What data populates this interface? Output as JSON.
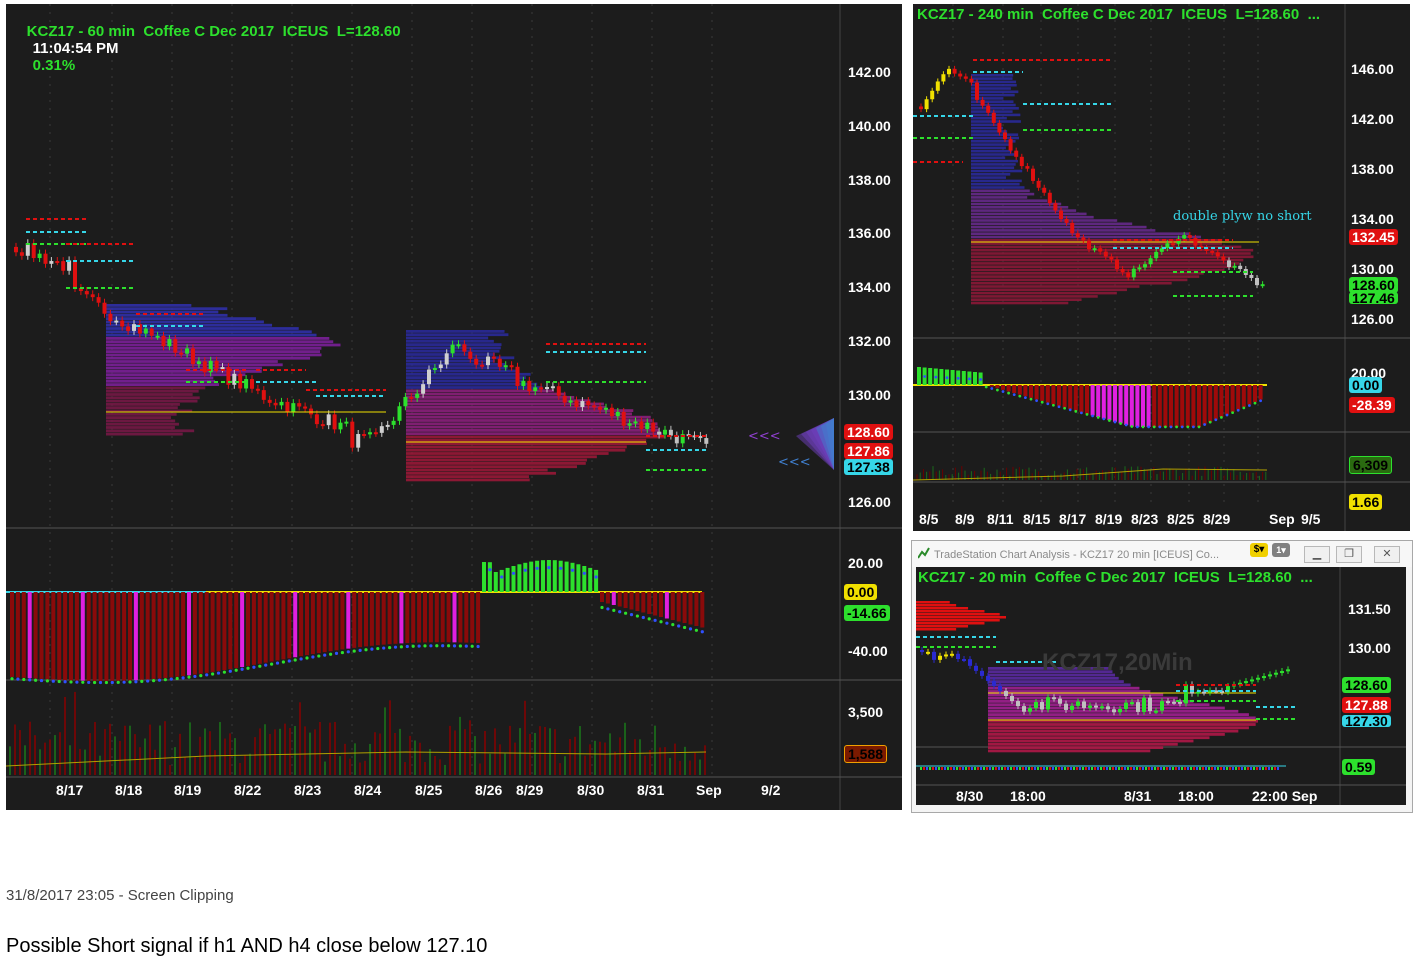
{
  "main_chart": {
    "title_left": "KCZ17 - 60 min  Coffee C Dec 2017  ICEUS  L=128.60",
    "time": "11:04:54 PM",
    "change": "0.31%",
    "price_ticks": [
      "142.00",
      "140.00",
      "138.00",
      "136.00",
      "134.00",
      "132.00",
      "130.00",
      "128.00",
      "126.00"
    ],
    "tags": {
      "last": "128.60",
      "red": "127.86",
      "cyan": "127.38"
    },
    "osc_ticks": [
      "20.00",
      "-40.00"
    ],
    "osc_tags": {
      "zero": "0.00",
      "value": "-14.66"
    },
    "vol_tick": "3,500",
    "vol_tag": "1,588",
    "dates": [
      "8/17",
      "8/18",
      "8/19",
      "8/22",
      "8/23",
      "8/24",
      "8/25",
      "8/26",
      "8/29",
      "8/30",
      "8/31",
      "Sep",
      "9/2"
    ]
  },
  "h4_chart": {
    "title": "KCZ17 - 240 min  Coffee C Dec 2017  ICEUS  L=128.60  ...",
    "note": "double plyw no short",
    "price_ticks": [
      "146.00",
      "142.00",
      "138.00",
      "134.00",
      "130.00",
      "126.00"
    ],
    "tags": {
      "red": "132.45",
      "green": "128.60",
      "green2": "127.46"
    },
    "osc_ticks": [
      "20.00"
    ],
    "osc_tags": {
      "zero": "0.00",
      "value": "-28.39"
    },
    "vol_tags": {
      "vol": "6,309",
      "other": "1.66"
    },
    "dates": [
      "8/5",
      "8/9",
      "8/11",
      "8/15",
      "8/17",
      "8/19",
      "8/23",
      "8/25",
      "8/29",
      "Sep",
      "9/5"
    ]
  },
  "m20_window": {
    "window_title": "TradeStation Chart Analysis - KCZ17 20 min [ICEUS] Co...",
    "title": "KCZ17 - 20 min  Coffee C Dec 2017  ICEUS  L=128.60  ...",
    "watermark": "KCZ17,20Min",
    "price_ticks": [
      "131.50",
      "130.00"
    ],
    "tags": {
      "green": "128.60",
      "red": "127.88",
      "cyan": "127.30"
    },
    "osc_tag": "0.59",
    "dates": [
      "8/30",
      "18:00",
      "8/31",
      "18:00",
      "22:00 Sep"
    ]
  },
  "caption": {
    "clip": "31/8/2017 23:05 - Screen Clipping",
    "signal": "Possible Short signal if h1 AND h4 close below 127.10"
  },
  "colors": {
    "bg": "#1c1c1c",
    "green": "#2de02d",
    "red": "#e01010",
    "cyan": "#36d6e8",
    "yellow": "#f0e000",
    "magenta": "#e020e0"
  }
}
